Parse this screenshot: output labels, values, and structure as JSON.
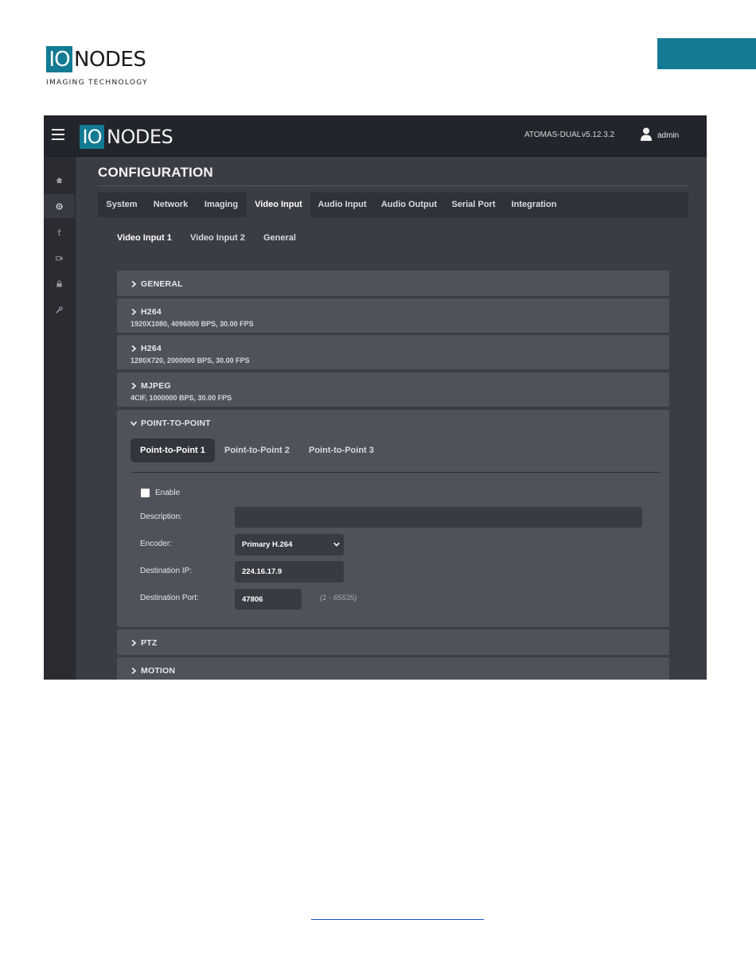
{
  "document": {
    "logo": {
      "io": "IO",
      "nodes": "NODES",
      "tagline": "IMAGING TECHNOLOGY"
    },
    "accent_color": "#137a94",
    "link_color": "#1d4fd0"
  },
  "app": {
    "logo": {
      "io": "IO",
      "nodes": "NODES"
    },
    "device_name": "ATOMAS-DUAL",
    "version": "v5.12.3.2",
    "user": "admin",
    "sidebar_icons": [
      "home-icon",
      "gear-icon",
      "usb-icon",
      "camera-icon",
      "lock-icon",
      "wrench-icon"
    ],
    "page_title": "CONFIGURATION",
    "tabs": [
      "System",
      "Network",
      "Imaging",
      "Video Input",
      "Audio Input",
      "Audio Output",
      "Serial Port",
      "Integration"
    ],
    "active_tab": "Video Input",
    "subtabs": [
      "Video Input 1",
      "Video Input 2",
      "General"
    ],
    "active_subtab": "Video Input 1",
    "sections": [
      {
        "title": "GENERAL",
        "subtitle": ""
      },
      {
        "title": "H264",
        "subtitle": "1920X1080, 4096000 BPS, 30.00 FPS"
      },
      {
        "title": "H264",
        "subtitle": "1280X720, 2000000 BPS, 30.00 FPS"
      },
      {
        "title": "MJPEG",
        "subtitle": "4CIF, 1000000 BPS, 30.00 FPS"
      },
      {
        "title": "POINT-TO-POINT",
        "subtitle": ""
      },
      {
        "title": "PTZ",
        "subtitle": ""
      },
      {
        "title": "MOTION",
        "subtitle": ""
      }
    ],
    "point_to_point": {
      "tabs": [
        "Point-to-Point 1",
        "Point-to-Point 2",
        "Point-to-Point 3"
      ],
      "active_tab": "Point-to-Point 1",
      "enable_label": "Enable",
      "description_label": "Description:",
      "description_value": "",
      "encoder_label": "Encoder:",
      "encoder_value": "Primary H.264",
      "destination_ip_label": "Destination IP:",
      "destination_ip_value": "224.16.17.9",
      "destination_port_label": "Destination Port:",
      "destination_port_value": "47806",
      "port_range_hint": "(1 - 65535)"
    }
  }
}
